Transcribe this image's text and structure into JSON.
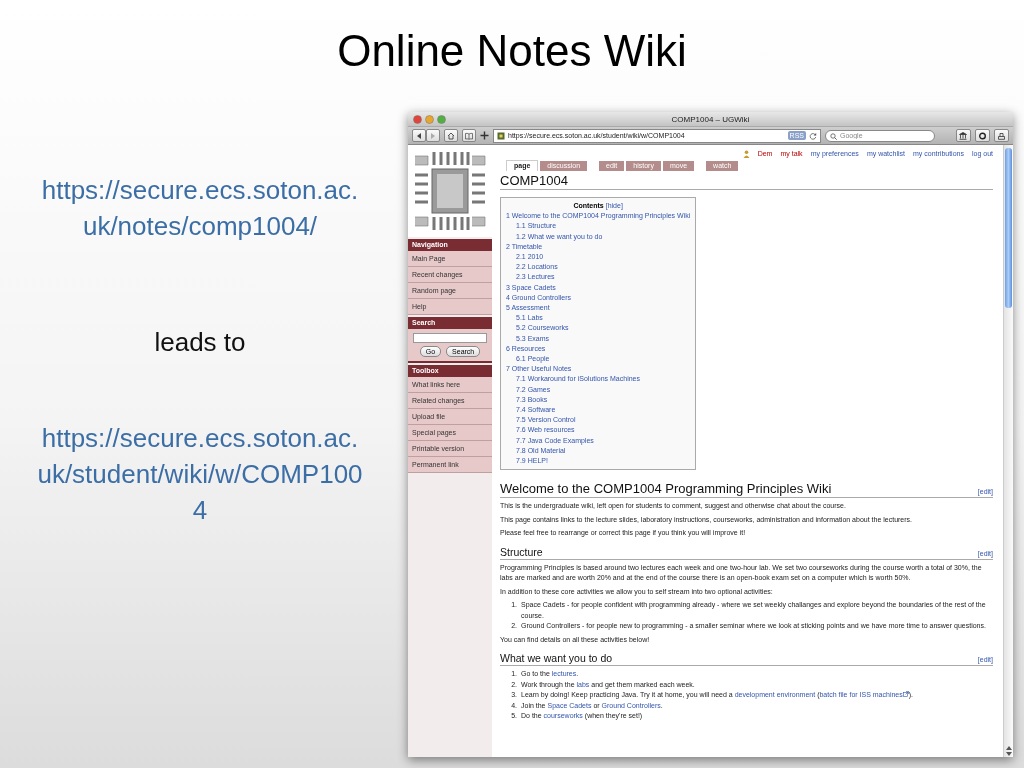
{
  "slide": {
    "title": "Online Notes Wiki",
    "texts": [
      {
        "kind": "link",
        "text": "https://secure.ecs.soton.ac.uk/notes/comp1004/"
      },
      {
        "kind": "plain",
        "text": "leads to"
      },
      {
        "kind": "link",
        "text": "https://secure.ecs.soton.ac.uk/student/wiki/w/COMP1004"
      }
    ]
  },
  "browser": {
    "title": "COMP1004 – UGWiki",
    "url": "https://secure.ecs.soton.ac.uk/student/wiki/w/COMP1004",
    "feed_badge": "RSS",
    "search": {
      "placeholder": "Google"
    },
    "user_links": [
      {
        "text": "Dem",
        "missing_page": true
      },
      {
        "text": "my talk",
        "missing_page": true
      },
      {
        "text": "my preferences",
        "missing_page": false
      },
      {
        "text": "my watchlist",
        "missing_page": false
      },
      {
        "text": "my contributions",
        "missing_page": false
      },
      {
        "text": "log out",
        "missing_page": false
      }
    ],
    "tab_groups": [
      [
        {
          "label": "page",
          "selected": true
        },
        {
          "label": "discussion",
          "selected": false
        }
      ],
      [
        {
          "label": "edit",
          "selected": false
        },
        {
          "label": "history",
          "selected": false
        },
        {
          "label": "move",
          "selected": false
        }
      ],
      [
        {
          "label": "watch",
          "selected": false
        }
      ]
    ],
    "sidebar": [
      {
        "kind": "links",
        "heading": "Navigation",
        "items": [
          "Main Page",
          "Recent changes",
          "Random page",
          "Help"
        ]
      },
      {
        "kind": "search",
        "heading": "Search",
        "buttons": [
          "Go",
          "Search"
        ]
      },
      {
        "kind": "links",
        "heading": "Toolbox",
        "items": [
          "What links here",
          "Related changes",
          "Upload file",
          "Special pages",
          "Printable version",
          "Permanent link"
        ]
      }
    ],
    "page_title": "COMP1004",
    "toc": {
      "title": "Contents",
      "toggle": "[hide]",
      "items": [
        {
          "text": "1 Welcome to the COMP1004 Programming Principles Wiki",
          "children": [
            {
              "text": "1.1 Structure"
            },
            {
              "text": "1.2 What we want you to do"
            }
          ]
        },
        {
          "text": "2 Timetable",
          "children": [
            {
              "text": "2.1 2010"
            },
            {
              "text": "2.2 Locations"
            },
            {
              "text": "2.3 Lectures"
            }
          ]
        },
        {
          "text": "3 Space Cadets"
        },
        {
          "text": "4 Ground Controllers"
        },
        {
          "text": "5 Assessment",
          "children": [
            {
              "text": "5.1 Labs"
            },
            {
              "text": "5.2 Courseworks"
            },
            {
              "text": "5.3 Exams"
            }
          ]
        },
        {
          "text": "6 Resources",
          "children": [
            {
              "text": "6.1 People"
            }
          ]
        },
        {
          "text": "7 Other Useful Notes",
          "children": [
            {
              "text": "7.1 Workaround for iSolutions Machines"
            },
            {
              "text": "7.2 Games"
            },
            {
              "text": "7.3 Books"
            },
            {
              "text": "7.4 Software"
            },
            {
              "text": "7.5 Version Control"
            },
            {
              "text": "7.6 Web resources"
            },
            {
              "text": "7.7 Java Code Examples"
            },
            {
              "text": "7.8 Old Material"
            },
            {
              "text": "7.9 HELP!"
            }
          ]
        }
      ]
    },
    "content": [
      {
        "kind": "h1",
        "text": "Welcome to the COMP1004 Programming Principles Wiki",
        "edit": "[edit]"
      },
      {
        "kind": "paragraph",
        "parts": [
          {
            "kind": "text",
            "text": "This is the undergraduate wiki, left open for students to comment, suggest and otherwise chat about the course."
          }
        ]
      },
      {
        "kind": "paragraph",
        "parts": [
          {
            "kind": "text",
            "text": "This page contains links to the lecture slides, laboratory instructions, courseworks, administration and information about the lecturers."
          }
        ]
      },
      {
        "kind": "paragraph",
        "parts": [
          {
            "kind": "text",
            "text": "Please feel free to rearrange or correct this page if you think you will improve it!"
          }
        ]
      },
      {
        "kind": "h2",
        "text": "Structure",
        "edit": "[edit]"
      },
      {
        "kind": "paragraph",
        "parts": [
          {
            "kind": "text",
            "text": "Programming Principles is based around two lectures each week and one two-hour lab. We set two courseworks during the course worth a total of 30%, the labs are marked and are worth 20% and at the end of the course there is an open-book exam set on a computer which is worth 50%."
          }
        ]
      },
      {
        "kind": "paragraph",
        "parts": [
          {
            "kind": "text",
            "text": "In addition to these core activities we allow you to self stream into two optional activities:"
          }
        ]
      },
      {
        "kind": "list",
        "items": [
          {
            "number": "1.",
            "parts": [
              {
                "kind": "text",
                "text": "Space Cadets - for people confident with programming already - where we set weekly challanges and explore beyond the boundaries of the rest of the course."
              }
            ]
          },
          {
            "number": "2.",
            "parts": [
              {
                "kind": "text",
                "text": "Ground Controllers - for people new to programming - a smaller seminar where we look at sticking points and we have more time to answer questions."
              }
            ]
          }
        ]
      },
      {
        "kind": "paragraph",
        "parts": [
          {
            "kind": "text",
            "text": "You can find details on all these activities below!"
          }
        ]
      },
      {
        "kind": "h2",
        "text": "What we want you to do",
        "edit": "[edit]"
      },
      {
        "kind": "list",
        "items": [
          {
            "number": "1.",
            "parts": [
              {
                "kind": "text",
                "text": "Go to the "
              },
              {
                "kind": "link",
                "text": "lectures"
              },
              {
                "kind": "text",
                "text": "."
              }
            ]
          },
          {
            "number": "2.",
            "parts": [
              {
                "kind": "text",
                "text": "Work through the "
              },
              {
                "kind": "link",
                "text": "labs"
              },
              {
                "kind": "text",
                "text": " and get them marked each week."
              }
            ]
          },
          {
            "number": "3.",
            "parts": [
              {
                "kind": "text",
                "text": "Learn by doing! Keep practicing Java. Try it at home, you will need a "
              },
              {
                "kind": "link",
                "text": "development environment"
              },
              {
                "kind": "text",
                "text": " ("
              },
              {
                "kind": "external_link",
                "text": "batch file for ISS machines"
              },
              {
                "kind": "text",
                "text": ")."
              }
            ]
          },
          {
            "number": "4.",
            "parts": [
              {
                "kind": "text",
                "text": "Join the "
              },
              {
                "kind": "link",
                "text": "Space Cadets"
              },
              {
                "kind": "text",
                "text": " or "
              },
              {
                "kind": "link",
                "text": "Ground Controllers"
              },
              {
                "kind": "text",
                "text": "."
              }
            ]
          },
          {
            "number": "5.",
            "parts": [
              {
                "kind": "text",
                "text": "Do the "
              },
              {
                "kind": "link",
                "text": "courseworks"
              },
              {
                "kind": "text",
                "text": " (when they're set!)"
              }
            ]
          }
        ]
      }
    ]
  }
}
